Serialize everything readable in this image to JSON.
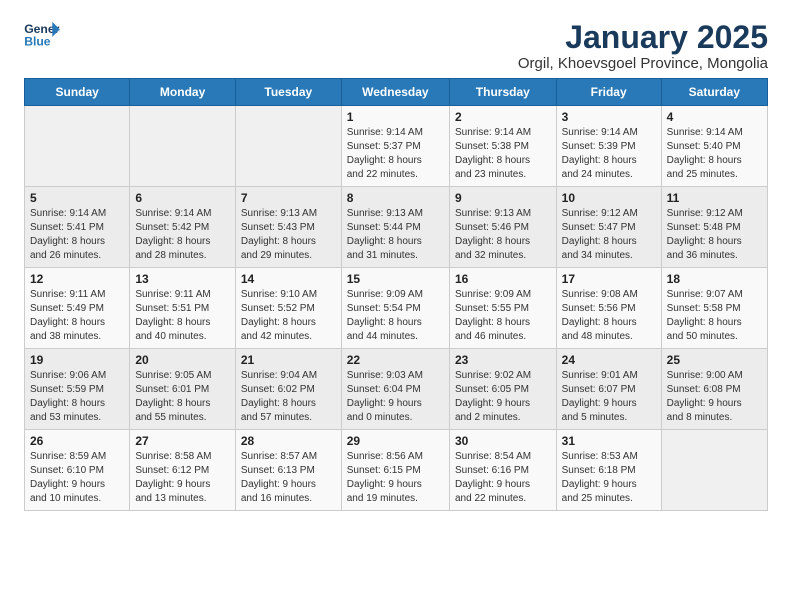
{
  "logo": {
    "line1": "General",
    "line2": "Blue"
  },
  "title": "January 2025",
  "subtitle": "Orgil, Khoevsgoel Province, Mongolia",
  "weekdays": [
    "Sunday",
    "Monday",
    "Tuesday",
    "Wednesday",
    "Thursday",
    "Friday",
    "Saturday"
  ],
  "weeks": [
    [
      {
        "day": "",
        "info": ""
      },
      {
        "day": "",
        "info": ""
      },
      {
        "day": "",
        "info": ""
      },
      {
        "day": "1",
        "info": "Sunrise: 9:14 AM\nSunset: 5:37 PM\nDaylight: 8 hours\nand 22 minutes."
      },
      {
        "day": "2",
        "info": "Sunrise: 9:14 AM\nSunset: 5:38 PM\nDaylight: 8 hours\nand 23 minutes."
      },
      {
        "day": "3",
        "info": "Sunrise: 9:14 AM\nSunset: 5:39 PM\nDaylight: 8 hours\nand 24 minutes."
      },
      {
        "day": "4",
        "info": "Sunrise: 9:14 AM\nSunset: 5:40 PM\nDaylight: 8 hours\nand 25 minutes."
      }
    ],
    [
      {
        "day": "5",
        "info": "Sunrise: 9:14 AM\nSunset: 5:41 PM\nDaylight: 8 hours\nand 26 minutes."
      },
      {
        "day": "6",
        "info": "Sunrise: 9:14 AM\nSunset: 5:42 PM\nDaylight: 8 hours\nand 28 minutes."
      },
      {
        "day": "7",
        "info": "Sunrise: 9:13 AM\nSunset: 5:43 PM\nDaylight: 8 hours\nand 29 minutes."
      },
      {
        "day": "8",
        "info": "Sunrise: 9:13 AM\nSunset: 5:44 PM\nDaylight: 8 hours\nand 31 minutes."
      },
      {
        "day": "9",
        "info": "Sunrise: 9:13 AM\nSunset: 5:46 PM\nDaylight: 8 hours\nand 32 minutes."
      },
      {
        "day": "10",
        "info": "Sunrise: 9:12 AM\nSunset: 5:47 PM\nDaylight: 8 hours\nand 34 minutes."
      },
      {
        "day": "11",
        "info": "Sunrise: 9:12 AM\nSunset: 5:48 PM\nDaylight: 8 hours\nand 36 minutes."
      }
    ],
    [
      {
        "day": "12",
        "info": "Sunrise: 9:11 AM\nSunset: 5:49 PM\nDaylight: 8 hours\nand 38 minutes."
      },
      {
        "day": "13",
        "info": "Sunrise: 9:11 AM\nSunset: 5:51 PM\nDaylight: 8 hours\nand 40 minutes."
      },
      {
        "day": "14",
        "info": "Sunrise: 9:10 AM\nSunset: 5:52 PM\nDaylight: 8 hours\nand 42 minutes."
      },
      {
        "day": "15",
        "info": "Sunrise: 9:09 AM\nSunset: 5:54 PM\nDaylight: 8 hours\nand 44 minutes."
      },
      {
        "day": "16",
        "info": "Sunrise: 9:09 AM\nSunset: 5:55 PM\nDaylight: 8 hours\nand 46 minutes."
      },
      {
        "day": "17",
        "info": "Sunrise: 9:08 AM\nSunset: 5:56 PM\nDaylight: 8 hours\nand 48 minutes."
      },
      {
        "day": "18",
        "info": "Sunrise: 9:07 AM\nSunset: 5:58 PM\nDaylight: 8 hours\nand 50 minutes."
      }
    ],
    [
      {
        "day": "19",
        "info": "Sunrise: 9:06 AM\nSunset: 5:59 PM\nDaylight: 8 hours\nand 53 minutes."
      },
      {
        "day": "20",
        "info": "Sunrise: 9:05 AM\nSunset: 6:01 PM\nDaylight: 8 hours\nand 55 minutes."
      },
      {
        "day": "21",
        "info": "Sunrise: 9:04 AM\nSunset: 6:02 PM\nDaylight: 8 hours\nand 57 minutes."
      },
      {
        "day": "22",
        "info": "Sunrise: 9:03 AM\nSunset: 6:04 PM\nDaylight: 9 hours\nand 0 minutes."
      },
      {
        "day": "23",
        "info": "Sunrise: 9:02 AM\nSunset: 6:05 PM\nDaylight: 9 hours\nand 2 minutes."
      },
      {
        "day": "24",
        "info": "Sunrise: 9:01 AM\nSunset: 6:07 PM\nDaylight: 9 hours\nand 5 minutes."
      },
      {
        "day": "25",
        "info": "Sunrise: 9:00 AM\nSunset: 6:08 PM\nDaylight: 9 hours\nand 8 minutes."
      }
    ],
    [
      {
        "day": "26",
        "info": "Sunrise: 8:59 AM\nSunset: 6:10 PM\nDaylight: 9 hours\nand 10 minutes."
      },
      {
        "day": "27",
        "info": "Sunrise: 8:58 AM\nSunset: 6:12 PM\nDaylight: 9 hours\nand 13 minutes."
      },
      {
        "day": "28",
        "info": "Sunrise: 8:57 AM\nSunset: 6:13 PM\nDaylight: 9 hours\nand 16 minutes."
      },
      {
        "day": "29",
        "info": "Sunrise: 8:56 AM\nSunset: 6:15 PM\nDaylight: 9 hours\nand 19 minutes."
      },
      {
        "day": "30",
        "info": "Sunrise: 8:54 AM\nSunset: 6:16 PM\nDaylight: 9 hours\nand 22 minutes."
      },
      {
        "day": "31",
        "info": "Sunrise: 8:53 AM\nSunset: 6:18 PM\nDaylight: 9 hours\nand 25 minutes."
      },
      {
        "day": "",
        "info": ""
      }
    ]
  ]
}
